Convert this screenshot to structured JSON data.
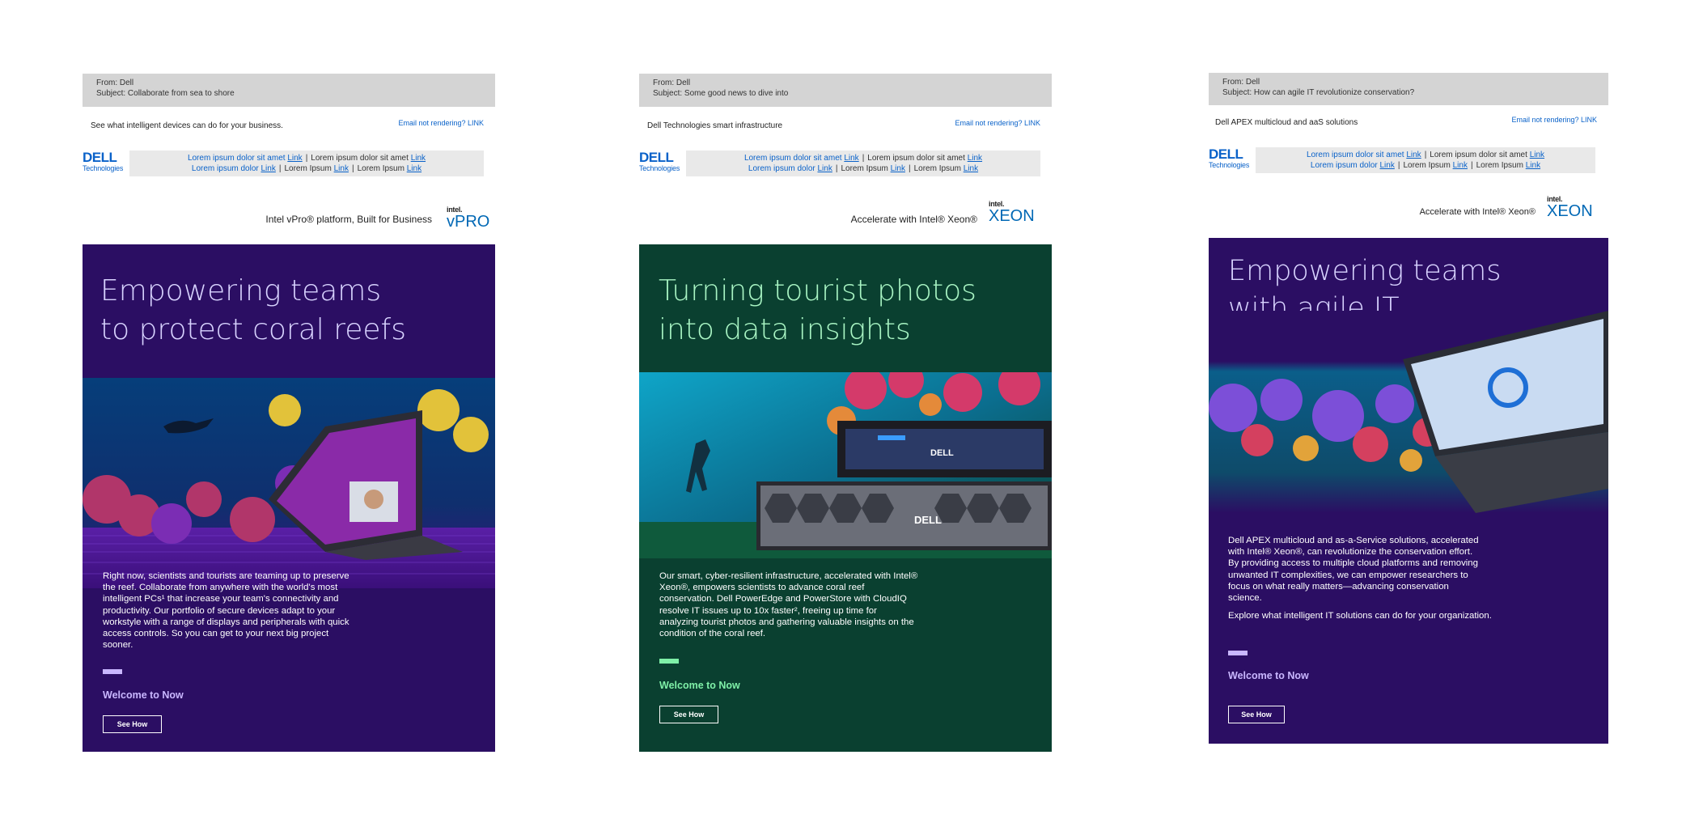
{
  "emails": [
    {
      "from": "From: Dell",
      "subject": "Subject: Collaborate from sea to shore",
      "preheader": "See what intelligent devices can do for your business.",
      "not_rendering": "Email not rendering? LINK",
      "dell_logo": {
        "word": "DELL",
        "sub": "Technologies"
      },
      "nav": {
        "row1_a": "Lorem ipsum dolor sit amet ",
        "row1_a_link": "Link",
        "row1_b": "Lorem ipsum dolor sit amet ",
        "row1_b_link": "Link",
        "row2_a": "Lorem ipsum dolor ",
        "row2_a_link": "Link",
        "row2_b": "Lorem Ipsum ",
        "row2_b_link": "Link",
        "row2_c": "Lorem Ipsum ",
        "row2_c_link": "Link"
      },
      "partner_text": "Intel vPro® platform, Built for Business",
      "intel_logo": {
        "intel": "intel.",
        "brand": "vPRO"
      },
      "headline_line1": "Empowering teams",
      "headline_line2": "to protect coral reefs",
      "body": "Right now, scientists and tourists are teaming up to preserve the reef. Collaborate from anywhere with the world's most intelligent PCs¹ that increase your team's connectivity and productivity. Our portfolio of secure devices adapt to your workstyle with a range of displays and peripherals with quick access controls. So you can get to your next big project sooner.",
      "welcome": "Welcome to Now",
      "cta": "See How",
      "colors": {
        "bg": "#2b0e63",
        "headline": "#d8d3ff",
        "accent": "#c9b7ff"
      }
    },
    {
      "from": "From: Dell",
      "subject": "Subject: Some good news to dive into",
      "preheader": "Dell Technologies smart infrastructure",
      "not_rendering": "Email not rendering? LINK",
      "dell_logo": {
        "word": "DELL",
        "sub": "Technologies"
      },
      "nav": {
        "row1_a": "Lorem ipsum dolor sit amet ",
        "row1_a_link": "Link",
        "row1_b": "Lorem ipsum dolor sit amet ",
        "row1_b_link": "Link",
        "row2_a": "Lorem ipsum dolor ",
        "row2_a_link": "Link",
        "row2_b": "Lorem Ipsum ",
        "row2_b_link": "Link",
        "row2_c": "Lorem Ipsum ",
        "row2_c_link": "Link"
      },
      "partner_text": "Accelerate with Intel® Xeon®",
      "intel_logo": {
        "intel": "intel.",
        "brand": "XEON"
      },
      "headline_line1": "Turning tourist photos",
      "headline_line2": "into data insights",
      "body": "Our smart, cyber-resilient infrastructure, accelerated with Intel® Xeon®, empowers scientists to advance coral reef conservation. Dell PowerEdge and PowerStore with CloudIQ resolve IT issues up to 10x faster², freeing up time for analyzing tourist photos and gathering valuable insights on the condition of the coral reef.",
      "welcome": "Welcome to Now",
      "cta": "See How",
      "server_label_top": "DELL",
      "server_label_bottom": "DELL",
      "colors": {
        "bg": "#0a4030",
        "headline": "#a9f5c4",
        "accent": "#7ff0a8"
      }
    },
    {
      "from": "From: Dell",
      "subject": "Subject: How can agile IT revolutionize conservation?",
      "preheader": "Dell APEX multicloud and aaS solutions",
      "not_rendering": "Email not rendering? LINK",
      "dell_logo": {
        "word": "DELL",
        "sub": "Technologies"
      },
      "nav": {
        "row1_a": "Lorem ipsum dolor sit amet ",
        "row1_a_link": "Link",
        "row1_b": "Lorem ipsum dolor sit amet ",
        "row1_b_link": "Link",
        "row2_a": "Lorem ipsum dolor ",
        "row2_a_link": "Link",
        "row2_b": "Lorem Ipsum ",
        "row2_b_link": "Link",
        "row2_c": "Lorem Ipsum ",
        "row2_c_link": "Link"
      },
      "partner_text": "Accelerate with Intel® Xeon®",
      "intel_logo": {
        "intel": "intel.",
        "brand": "XEON"
      },
      "headline_line1": "Empowering teams",
      "headline_line2": "with agile IT",
      "body": "Dell APEX multicloud and as-a-Service solutions, accelerated with Intel® Xeon®, can revolutionize the conservation effort. By providing access to multiple cloud platforms and removing unwanted IT complexities, we can empower researchers to focus on what really matters—advancing conservation science.",
      "body2": "Explore what intelligent IT solutions can do for your organization.",
      "welcome": "Welcome to Now",
      "cta": "See How",
      "colors": {
        "bg": "#2b0e63",
        "headline": "#d8d3ff",
        "accent": "#c9b7ff"
      }
    }
  ]
}
